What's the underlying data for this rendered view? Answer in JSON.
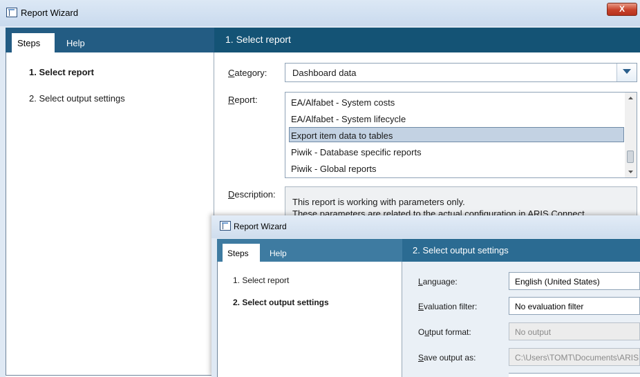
{
  "main_window": {
    "title": "Report Wizard",
    "close_glyph": "X",
    "tabs": [
      {
        "label": "Steps"
      },
      {
        "label": "Help"
      }
    ],
    "header": "1. Select report",
    "steps": [
      {
        "label": "1. Select report"
      },
      {
        "label": "2. Select output settings"
      }
    ],
    "form": {
      "category_label_key": "C",
      "category_label_rest": "ategory:",
      "category_value": "Dashboard data",
      "report_label_key": "R",
      "report_label_rest": "eport:",
      "reports": [
        {
          "label": "EA/Alfabet - System costs"
        },
        {
          "label": "EA/Alfabet - System lifecycle"
        },
        {
          "label": "Export item data to tables"
        },
        {
          "label": "Piwik - Database specific reports"
        },
        {
          "label": "Piwik - Global reports"
        }
      ],
      "selected_report": "Export item data to tables",
      "description_label_key": "D",
      "description_label_rest": "escription:",
      "description_line1": "This report is working with parameters only.",
      "description_line2": "These parameters are related to the actual configuration in ARIS Connect."
    }
  },
  "overlay_window": {
    "title": "Report Wizard",
    "tabs": [
      {
        "label": "Steps"
      },
      {
        "label": "Help"
      }
    ],
    "header": "2. Select output settings",
    "steps": [
      {
        "label": "1. Select report"
      },
      {
        "label": "2. Select output settings"
      }
    ],
    "fields": {
      "language_key": "L",
      "language_rest": "anguage:",
      "language_value": "English (United States)",
      "evalfilter_key": "E",
      "evalfilter_rest": "valuation filter:",
      "evalfilter_value": "No evaluation filter",
      "outformat_pre": "O",
      "outformat_key": "u",
      "outformat_rest": "tput format:",
      "outformat_value": "No output",
      "saveas_key": "S",
      "saveas_rest": "ave output as:",
      "saveas_value": "C:\\Users\\TOMT\\Documents\\ARIS"
    }
  },
  "colors": {
    "header_blue": "#145375",
    "tabstrip_blue": "#235c83",
    "selection": "#c3d2e3"
  },
  "icons": {
    "app": "report-wizard-icon",
    "dropdown": "chevron-down-icon"
  }
}
